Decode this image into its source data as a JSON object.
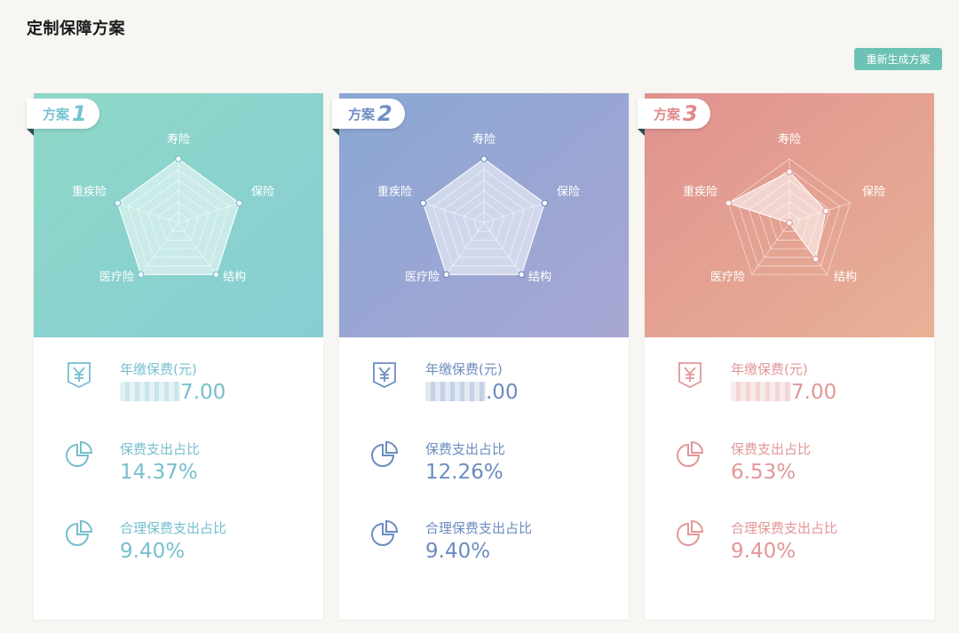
{
  "page": {
    "title": "定制保障方案"
  },
  "toolbar": {
    "regenerate_label": "重新生成方案"
  },
  "plans": [
    {
      "label": "方案",
      "number": "1",
      "theme": {
        "grad_start": "#8ed8c8",
        "grad_end": "#87cdd3",
        "accent": "#76bfcf",
        "ribbon": "#74c2d2"
      },
      "radar": {
        "axes": [
          "寿险",
          "保险",
          "结构",
          "医疗险",
          "重疾险"
        ],
        "values": [
          1,
          1,
          1,
          1,
          1
        ]
      },
      "stats": [
        {
          "icon": "yen-icon",
          "label": "年缴保费(元)",
          "value": "7.00",
          "redacted": true
        },
        {
          "icon": "pie-chart-icon",
          "label": "保费支出占比",
          "value": "14.37%"
        },
        {
          "icon": "pie-chart-icon",
          "label": "合理保费支出占比",
          "value": "9.40%"
        }
      ]
    },
    {
      "label": "方案",
      "number": "2",
      "theme": {
        "grad_start": "#8aa7d3",
        "grad_end": "#a8a6d3",
        "accent": "#6c8cc0",
        "ribbon": "#6f8fc4"
      },
      "radar": {
        "axes": [
          "寿险",
          "保险",
          "结构",
          "医疗险",
          "重疾险"
        ],
        "values": [
          1,
          1,
          1,
          1,
          1
        ]
      },
      "stats": [
        {
          "icon": "yen-icon",
          "label": "年缴保费(元)",
          "value": ".00",
          "redacted": true
        },
        {
          "icon": "pie-chart-icon",
          "label": "保费支出占比",
          "value": "12.26%"
        },
        {
          "icon": "pie-chart-icon",
          "label": "合理保费支出占比",
          "value": "9.40%"
        }
      ]
    },
    {
      "label": "方案",
      "number": "3",
      "theme": {
        "grad_start": "#e0918f",
        "grad_end": "#e8b296",
        "accent": "#e29798",
        "ribbon": "#e0898b"
      },
      "radar": {
        "axes": [
          "寿险",
          "保险",
          "结构",
          "医疗险",
          "重疾险"
        ],
        "values": [
          0.8,
          0.6,
          0.7,
          0.0,
          1.0
        ]
      },
      "stats": [
        {
          "icon": "yen-icon",
          "label": "年缴保费(元)",
          "value": "7.00",
          "redacted": true
        },
        {
          "icon": "pie-chart-icon",
          "label": "保费支出占比",
          "value": "6.53%"
        },
        {
          "icon": "pie-chart-icon",
          "label": "合理保费支出占比",
          "value": "9.40%"
        }
      ]
    }
  ]
}
